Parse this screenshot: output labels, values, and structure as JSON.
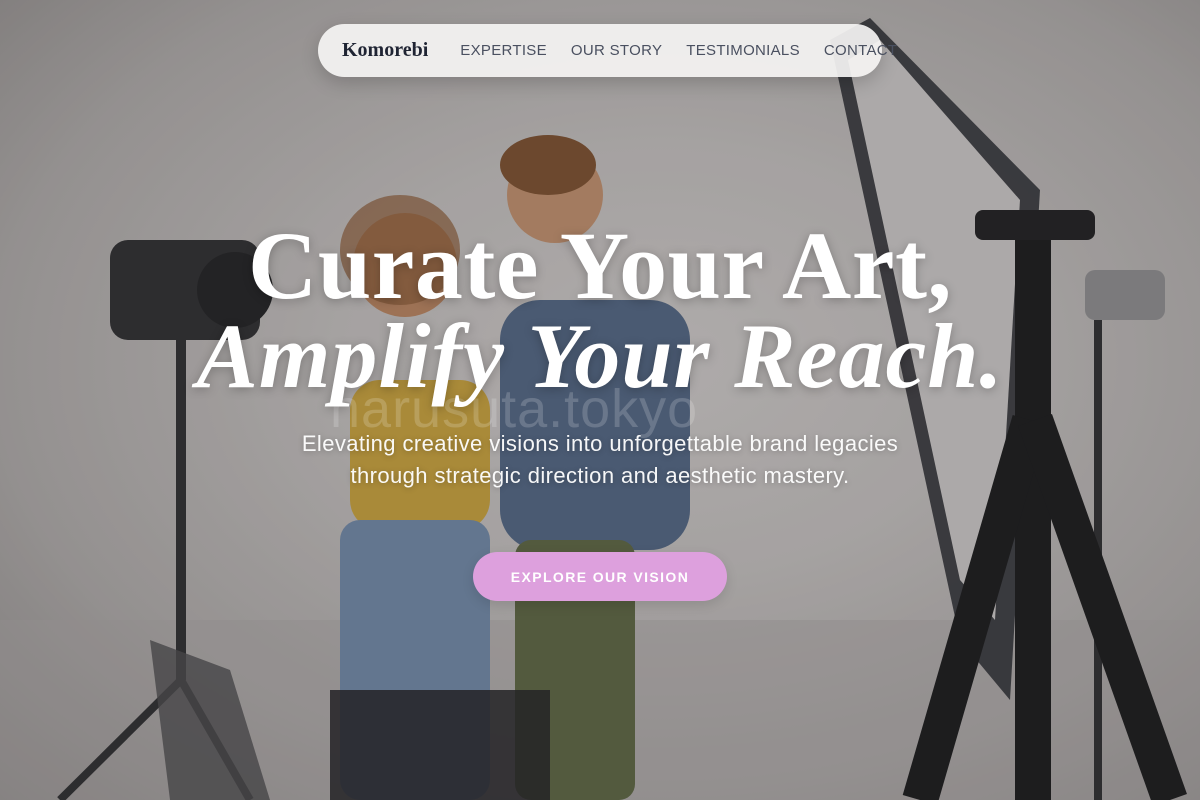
{
  "brand": "Komorebi",
  "nav": {
    "items": [
      {
        "label": "EXPERTISE"
      },
      {
        "label": "OUR STORY"
      },
      {
        "label": "TESTIMONIALS"
      },
      {
        "label": "CONTACT"
      }
    ]
  },
  "hero": {
    "headline_line1": "Curate Your Art,",
    "headline_line2": "Amplify Your Reach.",
    "subtitle": "Elevating creative visions into unforgettable brand legacies through strategic direction and aesthetic mastery.",
    "cta_label": "EXPLORE OUR VISION",
    "watermark": "harusuta.tokyo"
  },
  "colors": {
    "cta_background": "#dda0dd",
    "nav_background": "#f5f4f3",
    "brand_text": "#1f2433",
    "nav_text": "#4a5060",
    "headline_text": "#ffffff"
  }
}
